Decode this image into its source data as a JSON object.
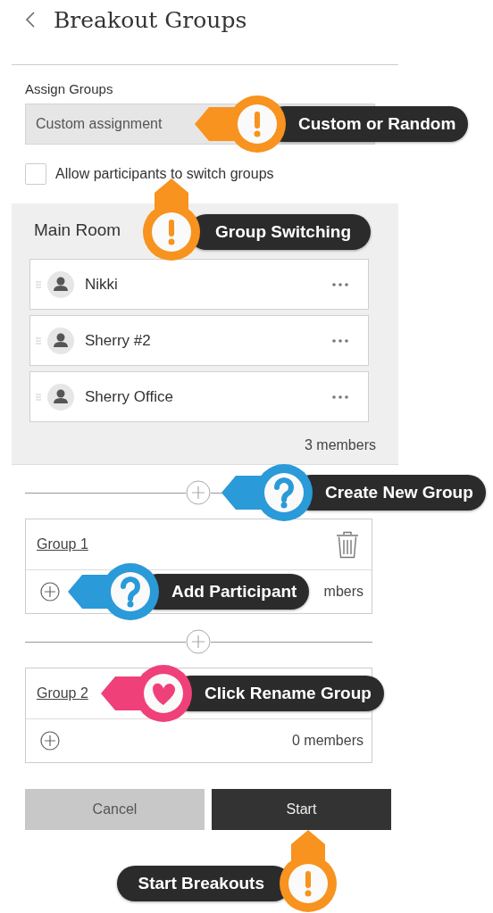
{
  "header": {
    "title": "Breakout Groups"
  },
  "assign": {
    "label": "Assign Groups",
    "value": "Custom assignment",
    "callout": {
      "text": "Custom or Random",
      "kind": "warning",
      "color": "#f7931e"
    }
  },
  "switch_option": {
    "label": "Allow participants to switch groups",
    "checked": false,
    "callout": {
      "text": "Group Switching",
      "kind": "warning",
      "color": "#f7931e"
    }
  },
  "main_room": {
    "title": "Main Room",
    "participants": [
      {
        "name": "Nikki"
      },
      {
        "name": "Sherry #2"
      },
      {
        "name": "Sherry Office"
      }
    ],
    "count": "3 members"
  },
  "create_group_callout": {
    "text": "Create New Group",
    "kind": "question",
    "color": "#2a9ad8"
  },
  "groups": [
    {
      "name": "Group 1",
      "count": "mbers",
      "delete_icon_visible": true,
      "footer_callout": {
        "text": "Add Participant",
        "kind": "question",
        "color": "#2a9ad8"
      }
    },
    {
      "name": "Group 2",
      "count": "0 members",
      "delete_icon_visible": false,
      "header_callout": {
        "text": "Click Rename Group",
        "kind": "heart",
        "color": "#f0407a"
      }
    }
  ],
  "buttons": [
    {
      "label": "Cancel",
      "kind": "secondary"
    },
    {
      "label": "Start",
      "kind": "primary"
    }
  ],
  "start_callout": {
    "text": "Start Breakouts",
    "kind": "warning",
    "color": "#f7931e"
  }
}
